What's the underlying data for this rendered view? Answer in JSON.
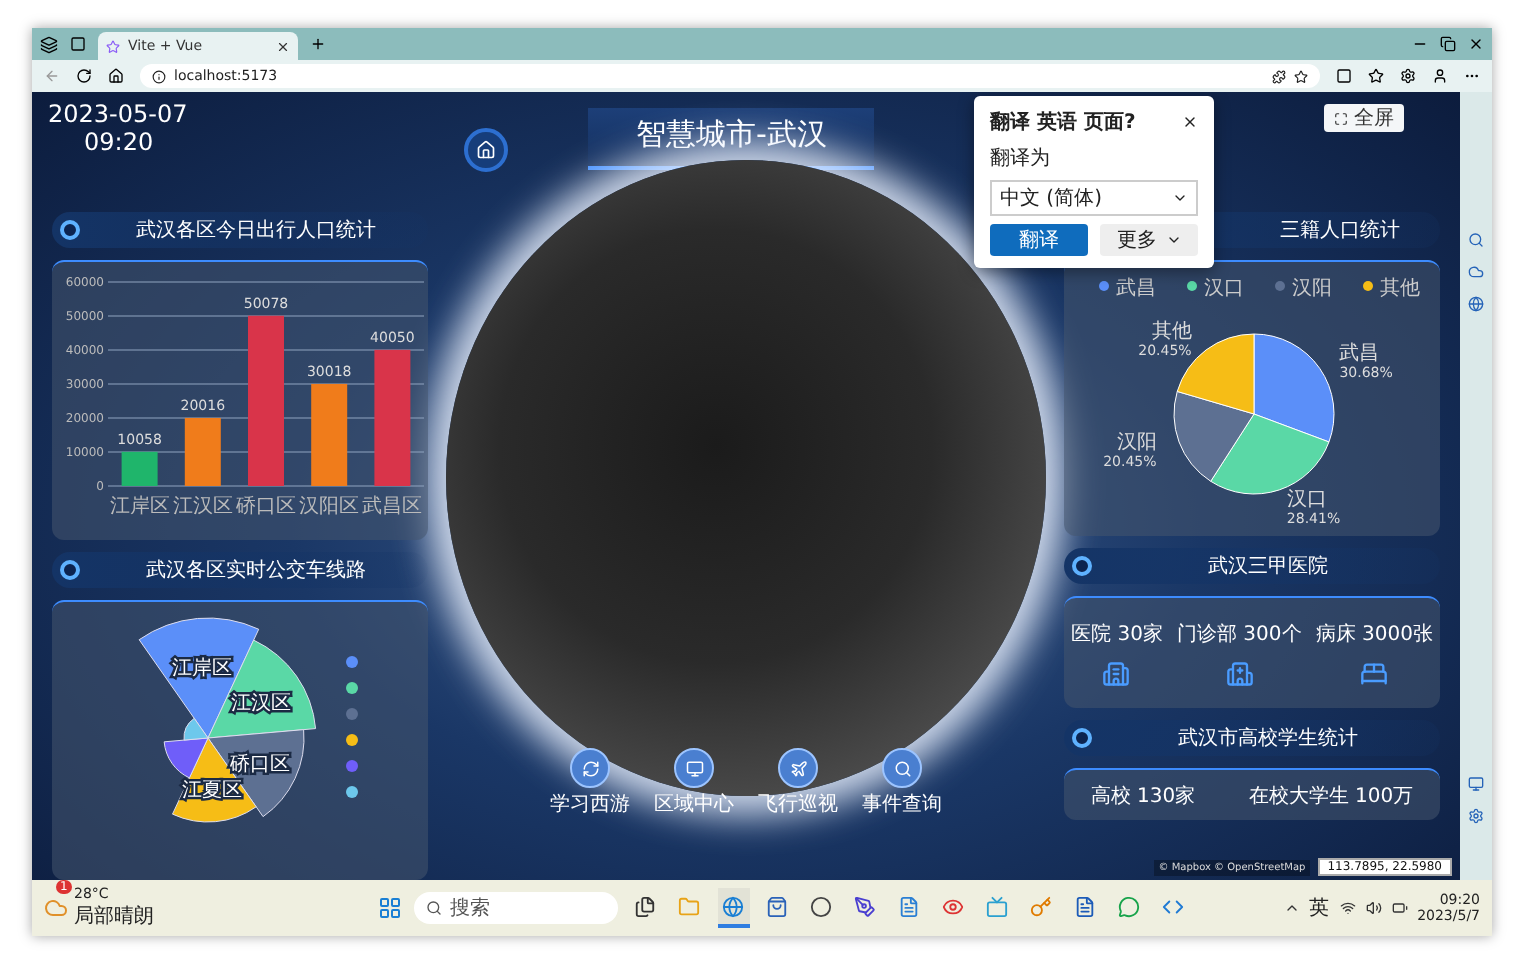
{
  "browser": {
    "tab": {
      "title": "Vite + Vue",
      "selected": true
    },
    "address": "localhost:5173"
  },
  "dashboard": {
    "date": "2023-05-07",
    "time": "09:20",
    "title": "智慧城市-武汉",
    "fullscreen_button": "全屏"
  },
  "travel_panel": {
    "title": "武汉各区今日出行人口统计",
    "chart_data": {
      "type": "bar",
      "categories": [
        "江岸区",
        "江汉区",
        "硚口区",
        "汉阳区",
        "武昌区"
      ],
      "values": [
        10058,
        20016,
        50078,
        30018,
        40050
      ],
      "colors": [
        "#1fb56b",
        "#f07c1b",
        "#d9344a",
        "#f07c1b",
        "#d9344a"
      ],
      "ylim": [
        0,
        60000
      ],
      "grid": true,
      "yticks": [
        0,
        10000,
        20000,
        30000,
        40000,
        50000,
        60000
      ],
      "value_labels": [
        "10058",
        "20016",
        "50078",
        "30018",
        "40050"
      ]
    }
  },
  "bus_panel": {
    "title": "武汉各区实时公交车线路",
    "segments": [
      {
        "label": "江岸区",
        "color": "#5b8ff9"
      },
      {
        "label": "江汉区",
        "color": "#5ad8a6"
      },
      {
        "label": "硚口区",
        "color": "#5d7092"
      },
      {
        "label": "江夏区",
        "color": "#f6bd16"
      },
      {
        "color": "#6f5ef9"
      },
      {
        "color": "#6dc8ec"
      }
    ],
    "legend": [
      {
        "color": "#5b8ff9"
      },
      {
        "color": "#5ad8a6"
      },
      {
        "color": "#5d7092"
      },
      {
        "color": "#f6bd16"
      },
      {
        "color": "#6f5ef9"
      },
      {
        "color": "#6dc8ec"
      }
    ]
  },
  "population_panel": {
    "title": "三籍人口统计",
    "legend": [
      "武昌",
      "汉口",
      "汉阳",
      "其他"
    ],
    "chart_data": {
      "type": "pie",
      "categories": [
        "武昌",
        "汉口",
        "汉阳",
        "其他"
      ],
      "values": [
        30.68,
        28.41,
        20.45,
        20.45
      ],
      "colors": [
        "#5b8ff9",
        "#5ad8a6",
        "#5d7092",
        "#f6bd16"
      ],
      "value_labels": [
        "30.68%",
        "28.41%",
        "20.45%",
        "20.45%"
      ]
    }
  },
  "hospital_panel": {
    "title": "武汉三甲医院",
    "stats": [
      {
        "label": "医院 30家",
        "kind": "hospital"
      },
      {
        "label": "门诊部 300个",
        "kind": "clinic"
      },
      {
        "label": "病床 3000张",
        "kind": "bed"
      }
    ]
  },
  "university_panel": {
    "title": "武汉市高校学生统计",
    "stats": [
      "高校 130家",
      "在校大学生 100万"
    ]
  },
  "nav_buttons": [
    {
      "label": "学习西游",
      "kind": "refresh"
    },
    {
      "label": "区域中心",
      "kind": "monitor"
    },
    {
      "label": "飞行巡视",
      "kind": "plane"
    },
    {
      "label": "事件查询",
      "kind": "search"
    }
  ],
  "map": {
    "attribution": "© Mapbox © OpenStreetMap",
    "coordinates": "113.7895, 22.5980"
  },
  "translate_popup": {
    "title": "翻译 英语 页面?",
    "target_label": "翻译为",
    "target_value": "中文 (简体)",
    "translate_button": "翻译",
    "more_button": "更多"
  },
  "taskbar": {
    "weather": {
      "temperature": "28°C",
      "condition": "局部晴朗",
      "badge": "1"
    },
    "search_placeholder": "搜索",
    "apps": [
      {
        "kind": "files",
        "selected": false
      },
      {
        "kind": "folder",
        "selected": false
      },
      {
        "kind": "browser",
        "selected": true
      },
      {
        "kind": "store",
        "selected": false
      },
      {
        "kind": "circle",
        "selected": false
      },
      {
        "kind": "pen",
        "selected": false
      },
      {
        "kind": "doc",
        "selected": false
      },
      {
        "kind": "eye",
        "selected": false
      },
      {
        "kind": "tv",
        "selected": false
      },
      {
        "kind": "key",
        "selected": false
      },
      {
        "kind": "word",
        "selected": false
      },
      {
        "kind": "chat",
        "selected": false
      },
      {
        "kind": "code",
        "selected": false
      }
    ],
    "ime": "英",
    "time": "09:20",
    "date": "2023/5/7"
  }
}
